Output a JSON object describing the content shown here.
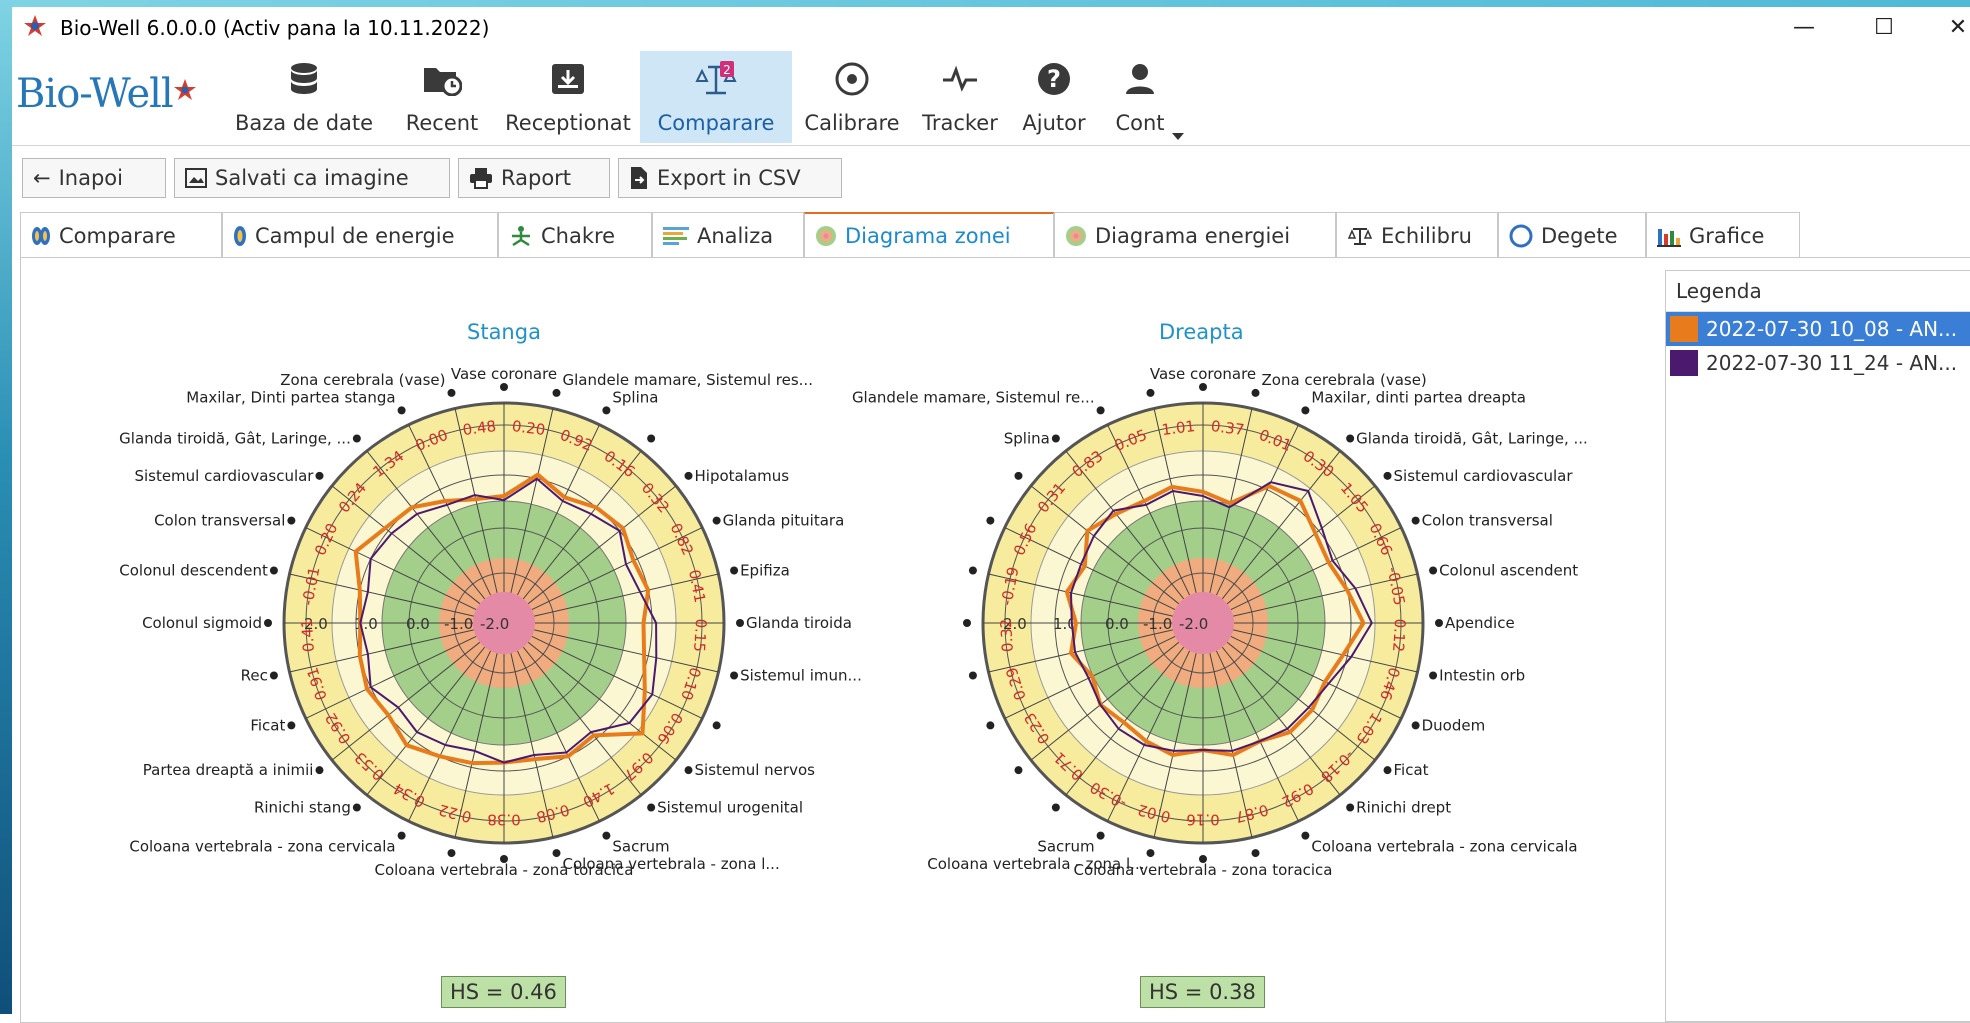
{
  "window": {
    "title": "Bio-Well 6.0.0.0 (Activ pana la 10.11.2022)",
    "minimize": "—",
    "maximize": "☐",
    "close": "✕"
  },
  "logo": "Bio-Well",
  "toolbar": [
    {
      "label": "Baza de date",
      "icon": "database-icon"
    },
    {
      "label": "Recent",
      "icon": "folder-clock-icon"
    },
    {
      "label": "Receptionat",
      "icon": "inbox-download-icon"
    },
    {
      "label": "Comparare",
      "icon": "balance-scale-icon",
      "badge": "2",
      "active": true
    },
    {
      "label": "Calibrare",
      "icon": "target-icon"
    },
    {
      "label": "Tracker",
      "icon": "pulse-icon"
    },
    {
      "label": "Ajutor",
      "icon": "help-icon"
    },
    {
      "label": "Cont",
      "icon": "user-icon"
    }
  ],
  "actions": [
    {
      "label": "Inapoi",
      "icon": "←"
    },
    {
      "label": "Salvati ca imagine",
      "icon": "image-icon"
    },
    {
      "label": "Raport",
      "icon": "printer-icon"
    },
    {
      "label": "Export in CSV",
      "icon": "file-export-icon"
    }
  ],
  "tabs": [
    {
      "label": "Comparare"
    },
    {
      "label": "Campul de energie"
    },
    {
      "label": "Chakre"
    },
    {
      "label": "Analiza"
    },
    {
      "label": "Diagrama zonei",
      "active": true
    },
    {
      "label": "Diagrama energiei"
    },
    {
      "label": "Echilibru"
    },
    {
      "label": "Degete"
    },
    {
      "label": "Grafice"
    }
  ],
  "legend": {
    "title": "Legenda",
    "items": [
      {
        "label": "2022-07-30 10_08 - AN...",
        "color": "#e87b1c",
        "selected": true
      },
      {
        "label": "2022-07-30 11_24 - AN...",
        "color": "#4b1a6e",
        "selected": false
      }
    ]
  },
  "colors": {
    "series1": "#e87b1c",
    "series2": "#4b1a6e",
    "ring_yellow": "#f7ec9e",
    "ring_cream": "#fbf7d3",
    "ring_green": "#a3cf8a",
    "ring_orange": "#f0ab7f",
    "center_pink": "#e48aa6"
  },
  "chart_data": [
    {
      "type": "radar",
      "title": "Stanga",
      "hs": "HS = 0.46",
      "scale_labels": [
        "2.0",
        "1.0",
        "0.0",
        "-1.0",
        "-2.0"
      ],
      "zone_labels": [
        "Vase coronare",
        "Glandele mamare, Sistemul res...",
        "Splina",
        "",
        "Hipotalamus",
        "Glanda pituitara",
        "Epifiza",
        "Glanda tiroida",
        "Sistemul imun...",
        "",
        "Sistemul nervos",
        "Sistemul urogenital",
        "Sacrum",
        "Coloana vertebrala - zona l...",
        "Coloana vertebrala - zona toracica",
        "",
        "Coloana vertebrala - zona cervicala",
        "Rinichi stang",
        "Partea dreaptă a inimii",
        "Ficat",
        "Rec",
        "Colonul sigmoid",
        "Colonul descendent",
        "Colon transversal",
        "Sistemul cardiovascular",
        "Glanda tiroidă, Gât, Laringe, ...",
        "Maxilar, Dinti partea stanga",
        "Zona cerebrala (vase)"
      ],
      "value_labels": [
        "0.20",
        "0.92",
        "0.16",
        "0.32",
        "0.82",
        "0.41",
        "0.15",
        "0.10",
        "0.06",
        "0.97",
        "1.40",
        "0.08",
        "0.38",
        "0.22",
        "0.34",
        "0.53",
        "0.92",
        "0.91",
        "0.41",
        "-0.01",
        "0.20",
        "0.24",
        "1.34",
        "0.00",
        "0.48"
      ],
      "series": [
        {
          "name": "2022-07-30 10_08 - AN...",
          "values": [
            0.3,
            0.9,
            0.6,
            0.8,
            0.9,
            0.7,
            0.8,
            0.6,
            0.7,
            1.0,
            1.5,
            0.7,
            0.8,
            0.6,
            0.6,
            0.7,
            0.8,
            1.0,
            0.8,
            0.9,
            0.8,
            0.7,
            0.8,
            1.2,
            0.9,
            0.8,
            0.5,
            0.3
          ]
        },
        {
          "name": "2022-07-30 11_24 - AN...",
          "values": [
            0.2,
            0.8,
            0.5,
            0.6,
            0.8,
            0.5,
            0.6,
            0.9,
            1.0,
            1.2,
            1.1,
            0.6,
            0.7,
            0.5,
            0.6,
            0.4,
            0.5,
            0.6,
            0.5,
            0.8,
            0.6,
            0.7,
            0.6,
            0.8,
            0.7,
            0.6,
            0.4,
            0.4
          ]
        }
      ]
    },
    {
      "type": "radar",
      "title": "Dreapta",
      "hs": "HS = 0.38",
      "scale_labels": [
        "2.0",
        "1.0",
        "0.0",
        "-1.0",
        "-2.0"
      ],
      "zone_labels": [
        "Vase coronare",
        "Zona cerebrala (vase)",
        "Maxilar, dinti partea dreapta",
        "Glanda tiroidă, Gât, Laringe, ...",
        "Sistemul cardiovascular",
        "Colon transversal",
        "Colonul ascendent",
        "Apendice",
        "Intestin orb",
        "Duodem",
        "Ficat",
        "Rinichi drept",
        "Coloana vertebrala - zona cervicala",
        "",
        "Coloana vertebrala - zona toracica",
        "Coloana vertebrala - zona l...",
        "Sacrum",
        "",
        "",
        "",
        "",
        "",
        "",
        "",
        "",
        "Splina",
        "Glandele mamare, Sistemul re...",
        ""
      ],
      "value_labels": [
        "0.37",
        "0.01",
        "0.30",
        "1.05",
        "0.66",
        "-0.05",
        "0.12",
        "0.46",
        "1.03",
        "-0.18",
        "0.92",
        "0.87",
        "0.16",
        "0.02",
        "-0.30",
        "0.71",
        "0.23",
        "0.29",
        "0.32",
        "-0.19",
        "0.56",
        "0.31",
        "0.83",
        "0.05",
        "1.01"
      ],
      "series": [
        {
          "name": "2022-07-30 10_08 - AN...",
          "values": [
            0.4,
            0.2,
            0.9,
            1.0,
            0.7,
            0.6,
            0.8,
            1.1,
            0.7,
            0.5,
            0.6,
            0.6,
            0.4,
            0.5,
            0.3,
            0.5,
            0.4,
            0.3,
            0.4,
            0.2,
            0.5,
            0.3,
            0.6,
            0.4,
            0.8,
            0.6,
            0.5,
            0.6
          ]
        },
        {
          "name": "2022-07-30 11_24 - AN...",
          "values": [
            0.3,
            0.1,
            1.0,
            1.3,
            0.9,
            0.7,
            1.0,
            1.3,
            0.9,
            0.6,
            0.5,
            0.5,
            0.4,
            0.4,
            0.3,
            0.4,
            0.5,
            0.5,
            0.4,
            0.3,
            0.4,
            0.4,
            0.5,
            0.5,
            0.6,
            0.7,
            0.4,
            0.5
          ]
        }
      ]
    }
  ]
}
